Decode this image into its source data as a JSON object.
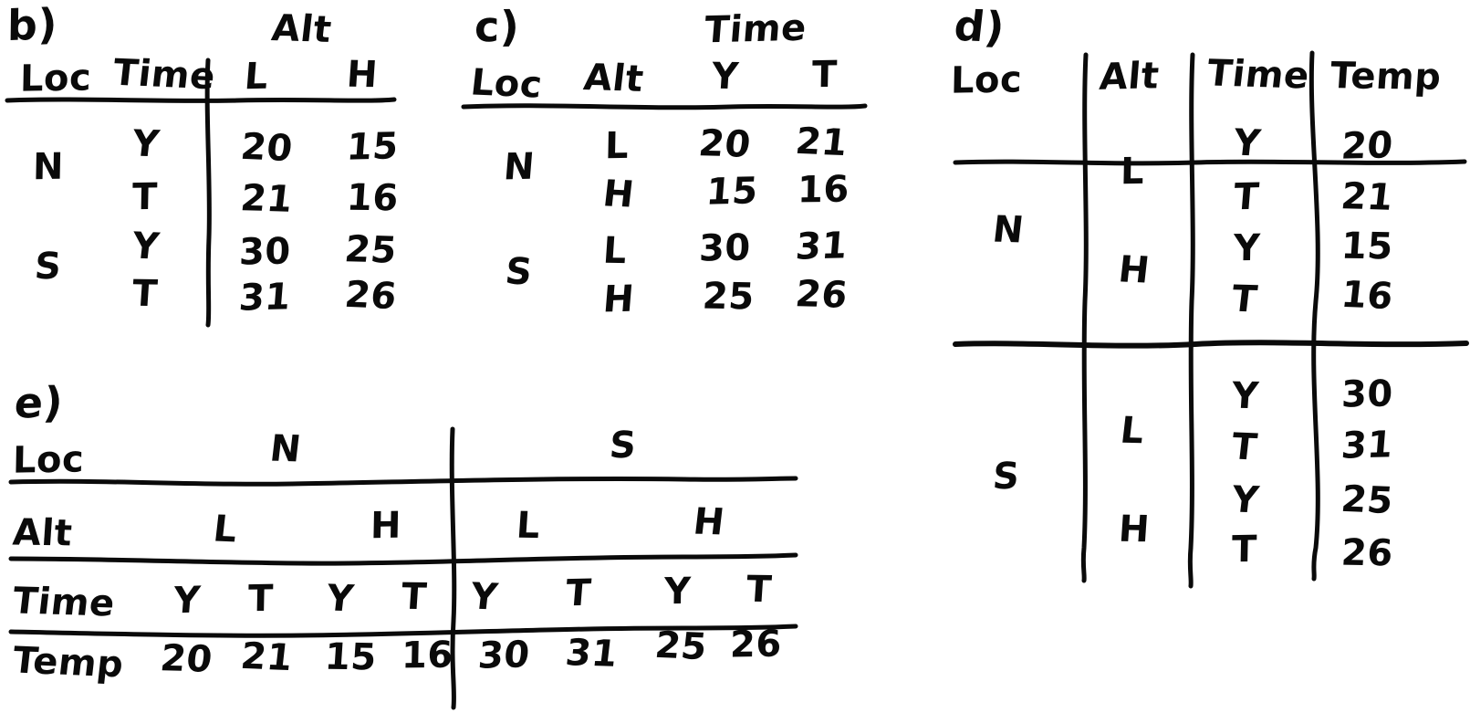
{
  "background": "#ffffff",
  "ink_color": "#0a0a0a",
  "panels": {
    "b": {
      "label": "b)",
      "spanner_header": "Alt",
      "row_headers": [
        "Loc",
        "Time"
      ],
      "alt_columns": [
        "L",
        "H"
      ],
      "rows": [
        {
          "loc": "N",
          "time": "Y",
          "L": "20",
          "H": "15"
        },
        {
          "loc": "",
          "time": "T",
          "L": "21",
          "H": "16"
        },
        {
          "loc": "S",
          "time": "Y",
          "L": "30",
          "H": "25"
        },
        {
          "loc": "",
          "time": "T",
          "L": "31",
          "H": "26"
        }
      ]
    },
    "c": {
      "label": "c)",
      "spanner_header": "Time",
      "row_headers": [
        "Loc",
        "Alt"
      ],
      "time_columns": [
        "Y",
        "T"
      ],
      "rows": [
        {
          "loc": "N",
          "alt": "L",
          "Y": "20",
          "T": "21"
        },
        {
          "loc": "",
          "alt": "H",
          "Y": "15",
          "T": "16"
        },
        {
          "loc": "S",
          "alt": "L",
          "Y": "30",
          "T": "31"
        },
        {
          "loc": "",
          "alt": "H",
          "Y": "25",
          "T": "26"
        }
      ]
    },
    "d": {
      "label": "d)",
      "headers": [
        "Loc",
        "Alt",
        "Time",
        "Temp"
      ],
      "groups": [
        {
          "loc": "N",
          "entries": [
            {
              "alt": "L",
              "time": "Y",
              "temp": "20"
            },
            {
              "alt": "",
              "time": "T",
              "temp": "21"
            },
            {
              "alt": "H",
              "time": "Y",
              "temp": "15"
            },
            {
              "alt": "",
              "time": "T",
              "temp": "16"
            }
          ]
        },
        {
          "loc": "S",
          "entries": [
            {
              "alt": "L",
              "time": "Y",
              "temp": "30"
            },
            {
              "alt": "",
              "time": "T",
              "temp": "31"
            },
            {
              "alt": "H",
              "time": "Y",
              "temp": "25"
            },
            {
              "alt": "",
              "time": "T",
              "temp": "26"
            }
          ]
        }
      ]
    },
    "e": {
      "label": "e)",
      "row_labels": [
        "Loc",
        "Alt",
        "Time",
        "Temp"
      ],
      "loc_row": [
        "N",
        "S"
      ],
      "alt_row": [
        "L",
        "H",
        "L",
        "H"
      ],
      "time_row": [
        "Y",
        "T",
        "Y",
        "T",
        "Y",
        "T",
        "Y",
        "T"
      ],
      "temp_row": [
        "20",
        "21",
        "15",
        "16",
        "30",
        "31",
        "25",
        "26"
      ]
    }
  }
}
